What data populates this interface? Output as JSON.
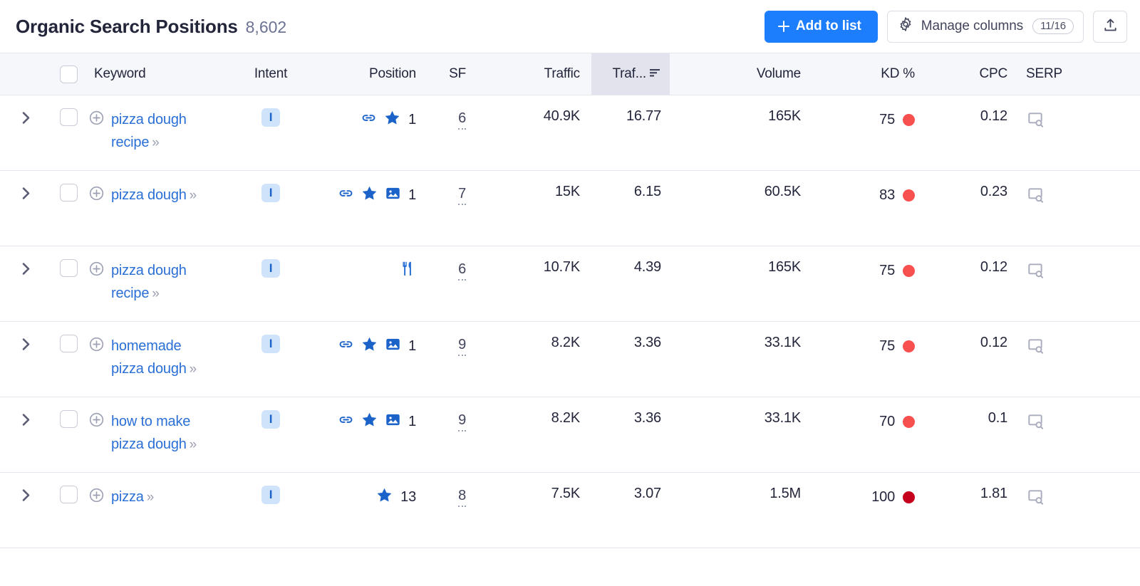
{
  "header": {
    "title": "Organic Search Positions",
    "count": "8,602",
    "add_to_list_label": "Add to list",
    "manage_columns_label": "Manage columns",
    "manage_columns_badge": "11/16",
    "export_icon": "export-upload-icon",
    "gear_icon": "gear-icon",
    "plus_icon": "plus-icon",
    "accent_color": "#1d7efd"
  },
  "table": {
    "columns": [
      {
        "key": "expand",
        "label": ""
      },
      {
        "key": "select",
        "label": ""
      },
      {
        "key": "keyword",
        "label": "Keyword"
      },
      {
        "key": "intent",
        "label": "Intent"
      },
      {
        "key": "position",
        "label": "Position"
      },
      {
        "key": "sf",
        "label": "SF"
      },
      {
        "key": "traffic",
        "label": "Traffic"
      },
      {
        "key": "traffic_pct",
        "label": "Traf...",
        "sorted": true,
        "sort_dir": "desc"
      },
      {
        "key": "volume",
        "label": "Volume"
      },
      {
        "key": "kd",
        "label": "KD %"
      },
      {
        "key": "cpc",
        "label": "CPC"
      },
      {
        "key": "serp",
        "label": "SERP"
      }
    ],
    "select_all_checked": false,
    "rows": [
      {
        "keyword": "pizza dough recipe",
        "intent": "I",
        "features": [
          "link-icon",
          "star-icon"
        ],
        "position": "1",
        "sf": "6",
        "traffic": "40.9K",
        "traffic_pct": "16.77",
        "volume": "165K",
        "kd": "75",
        "kd_color": "#f8504f",
        "cpc": "0.12",
        "serp_icon": "serp-preview-icon"
      },
      {
        "keyword": "pizza dough",
        "intent": "I",
        "features": [
          "link-icon",
          "star-icon",
          "image-icon"
        ],
        "position": "1",
        "sf": "7",
        "traffic": "15K",
        "traffic_pct": "6.15",
        "volume": "60.5K",
        "kd": "83",
        "kd_color": "#f8504f",
        "cpc": "0.23",
        "serp_icon": "serp-preview-icon"
      },
      {
        "keyword": "pizza dough recipe",
        "intent": "I",
        "features": [
          "recipe-icon"
        ],
        "position": "",
        "sf": "6",
        "traffic": "10.7K",
        "traffic_pct": "4.39",
        "volume": "165K",
        "kd": "75",
        "kd_color": "#f8504f",
        "cpc": "0.12",
        "serp_icon": "serp-preview-icon"
      },
      {
        "keyword": "homemade pizza dough",
        "intent": "I",
        "features": [
          "link-icon",
          "star-icon",
          "image-icon"
        ],
        "position": "1",
        "sf": "9",
        "traffic": "8.2K",
        "traffic_pct": "3.36",
        "volume": "33.1K",
        "kd": "75",
        "kd_color": "#f8504f",
        "cpc": "0.12",
        "serp_icon": "serp-preview-icon"
      },
      {
        "keyword": "how to make pizza dough",
        "intent": "I",
        "features": [
          "link-icon",
          "star-icon",
          "image-icon"
        ],
        "position": "1",
        "sf": "9",
        "traffic": "8.2K",
        "traffic_pct": "3.36",
        "volume": "33.1K",
        "kd": "70",
        "kd_color": "#f8504f",
        "cpc": "0.1",
        "serp_icon": "serp-preview-icon"
      },
      {
        "keyword": "pizza",
        "intent": "I",
        "features": [
          "star-icon"
        ],
        "position": "13",
        "sf": "8",
        "traffic": "7.5K",
        "traffic_pct": "3.07",
        "volume": "1.5M",
        "kd": "100",
        "kd_color": "#c4001d",
        "cpc": "1.81",
        "serp_icon": "serp-preview-icon"
      }
    ]
  }
}
